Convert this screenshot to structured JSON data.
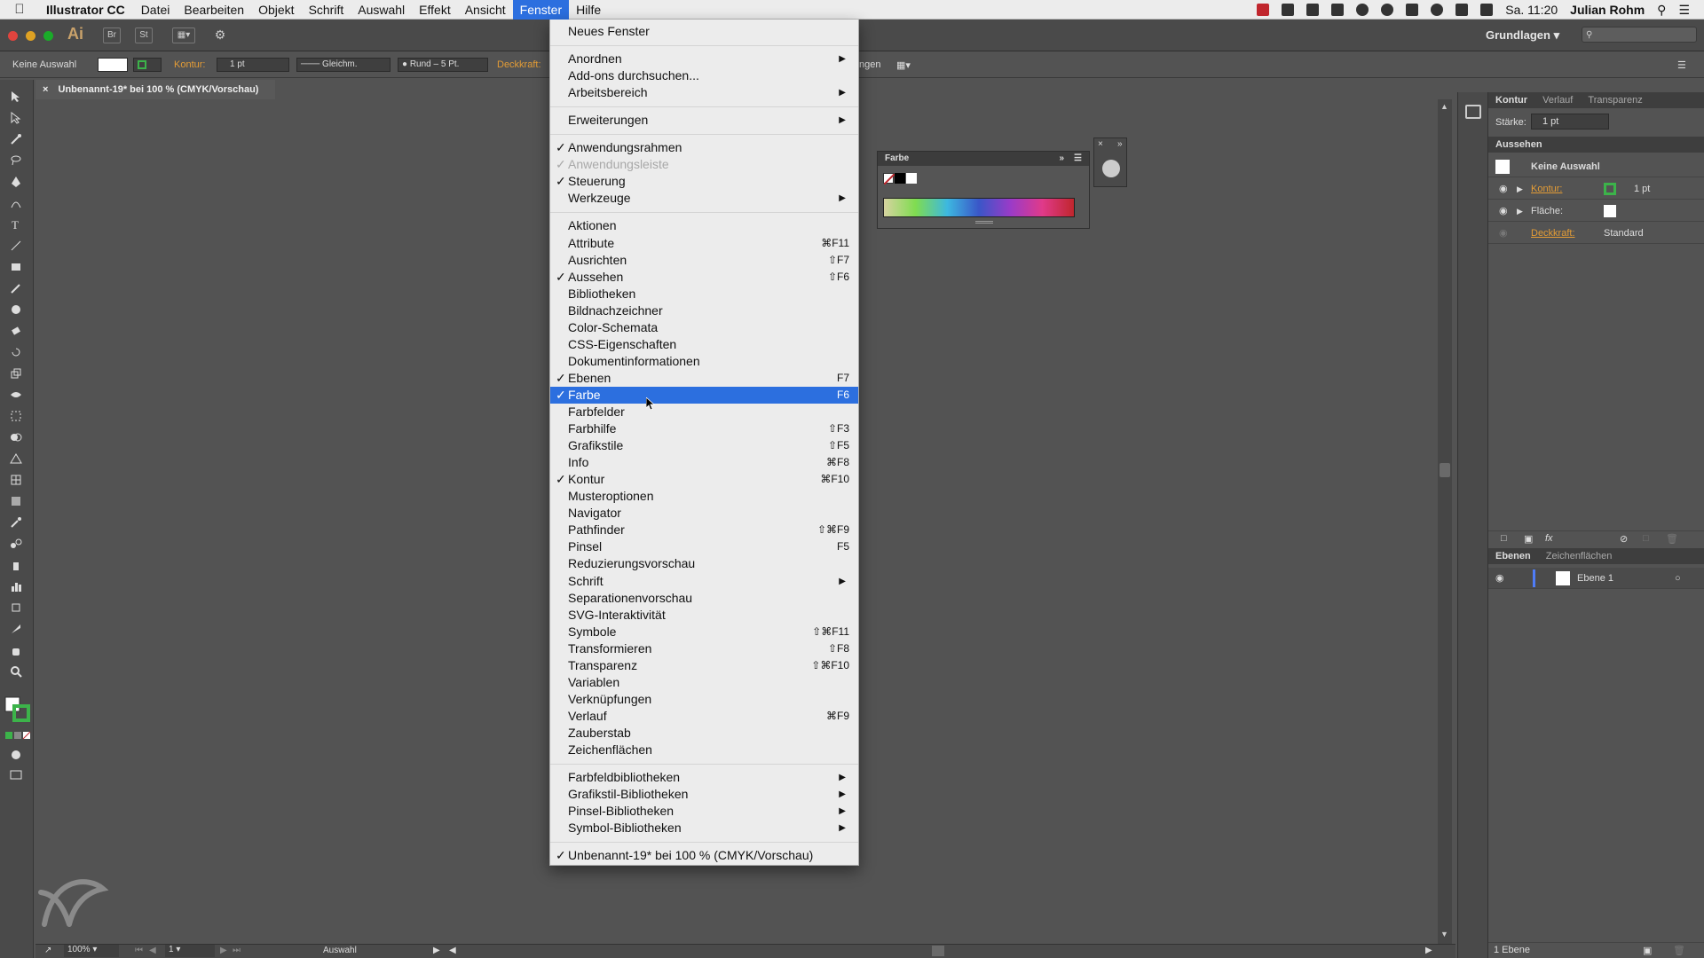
{
  "menubar": {
    "app_name": "Illustrator CC",
    "items": [
      "Datei",
      "Bearbeiten",
      "Objekt",
      "Schrift",
      "Auswahl",
      "Effekt",
      "Ansicht",
      "Fenster",
      "Hilfe"
    ],
    "active_item": "Fenster",
    "clock": "Sa. 11:20",
    "user": "Julian Rohm"
  },
  "appbar": {
    "logo": "Ai",
    "bridge": "Br",
    "stock": "St",
    "workspace": "Grundlagen"
  },
  "controlbar": {
    "selection": "Keine Auswahl",
    "stroke_label": "Kontur:",
    "stroke_value": "1 pt",
    "stroke_profile": "Gleichm.",
    "brush": "Rund – 5 Pt.",
    "opacity_label": "Deckkraft:",
    "partial": "ngen"
  },
  "document_tab": {
    "title": "Unbenannt-19* bei 100 % (CMYK/Vorschau)"
  },
  "fenster_menu": {
    "items": [
      {
        "label": "Neues Fenster",
        "checked": false,
        "shortcut": "",
        "submenu": false,
        "top": 0
      },
      {
        "label": "Anordnen",
        "checked": false,
        "shortcut": "",
        "submenu": true
      },
      {
        "label": "Add-ons durchsuchen...",
        "checked": false,
        "shortcut": "",
        "submenu": false
      },
      {
        "label": "Arbeitsbereich",
        "checked": false,
        "shortcut": "",
        "submenu": true
      },
      {
        "label": "Erweiterungen",
        "checked": false,
        "shortcut": "",
        "submenu": true
      },
      {
        "label": "Anwendungsrahmen",
        "checked": true,
        "shortcut": "",
        "submenu": false
      },
      {
        "label": "Anwendungsleiste",
        "checked": true,
        "shortcut": "",
        "submenu": false,
        "disabled": true
      },
      {
        "label": "Steuerung",
        "checked": true,
        "shortcut": "",
        "submenu": false
      },
      {
        "label": "Werkzeuge",
        "checked": false,
        "shortcut": "",
        "submenu": true
      },
      {
        "label": "Aktionen",
        "checked": false,
        "shortcut": "",
        "submenu": false
      },
      {
        "label": "Attribute",
        "checked": false,
        "shortcut": "⌘F11",
        "submenu": false
      },
      {
        "label": "Ausrichten",
        "checked": false,
        "shortcut": "⇧F7",
        "submenu": false
      },
      {
        "label": "Aussehen",
        "checked": true,
        "shortcut": "⇧F6",
        "submenu": false
      },
      {
        "label": "Bibliotheken",
        "checked": false,
        "shortcut": "",
        "submenu": false
      },
      {
        "label": "Bildnachzeichner",
        "checked": false,
        "shortcut": "",
        "submenu": false
      },
      {
        "label": "Color-Schemata",
        "checked": false,
        "shortcut": "",
        "submenu": false
      },
      {
        "label": "CSS-Eigenschaften",
        "checked": false,
        "shortcut": "",
        "submenu": false
      },
      {
        "label": "Dokumentinformationen",
        "checked": false,
        "shortcut": "",
        "submenu": false
      },
      {
        "label": "Ebenen",
        "checked": true,
        "shortcut": "F7",
        "submenu": false
      },
      {
        "label": "Farbe",
        "checked": true,
        "shortcut": "F6",
        "submenu": false,
        "highlight": true
      },
      {
        "label": "Farbfelder",
        "checked": false,
        "shortcut": "",
        "submenu": false
      },
      {
        "label": "Farbhilfe",
        "checked": false,
        "shortcut": "⇧F3",
        "submenu": false
      },
      {
        "label": "Grafikstile",
        "checked": false,
        "shortcut": "⇧F5",
        "submenu": false
      },
      {
        "label": "Info",
        "checked": false,
        "shortcut": "⌘F8",
        "submenu": false
      },
      {
        "label": "Kontur",
        "checked": true,
        "shortcut": "⌘F10",
        "submenu": false
      },
      {
        "label": "Musteroptionen",
        "checked": false,
        "shortcut": "",
        "submenu": false
      },
      {
        "label": "Navigator",
        "checked": false,
        "shortcut": "",
        "submenu": false
      },
      {
        "label": "Pathfinder",
        "checked": false,
        "shortcut": "⇧⌘F9",
        "submenu": false
      },
      {
        "label": "Pinsel",
        "checked": false,
        "shortcut": "F5",
        "submenu": false
      },
      {
        "label": "Reduzierungsvorschau",
        "checked": false,
        "shortcut": "",
        "submenu": false
      },
      {
        "label": "Schrift",
        "checked": false,
        "shortcut": "",
        "submenu": true
      },
      {
        "label": "Separationenvorschau",
        "checked": false,
        "shortcut": "",
        "submenu": false
      },
      {
        "label": "SVG-Interaktivität",
        "checked": false,
        "shortcut": "",
        "submenu": false
      },
      {
        "label": "Symbole",
        "checked": false,
        "shortcut": "⇧⌘F11",
        "submenu": false
      },
      {
        "label": "Transformieren",
        "checked": false,
        "shortcut": "⇧F8",
        "submenu": false
      },
      {
        "label": "Transparenz",
        "checked": false,
        "shortcut": "⇧⌘F10",
        "submenu": false
      },
      {
        "label": "Variablen",
        "checked": false,
        "shortcut": "",
        "submenu": false
      },
      {
        "label": "Verknüpfungen",
        "checked": false,
        "shortcut": "",
        "submenu": false
      },
      {
        "label": "Verlauf",
        "checked": false,
        "shortcut": "⌘F9",
        "submenu": false
      },
      {
        "label": "Zauberstab",
        "checked": false,
        "shortcut": "",
        "submenu": false
      },
      {
        "label": "Zeichenflächen",
        "checked": false,
        "shortcut": "",
        "submenu": false
      },
      {
        "label": "Farbfeldbibliotheken",
        "checked": false,
        "shortcut": "",
        "submenu": true
      },
      {
        "label": "Grafikstil-Bibliotheken",
        "checked": false,
        "shortcut": "",
        "submenu": true
      },
      {
        "label": "Pinsel-Bibliotheken",
        "checked": false,
        "shortcut": "",
        "submenu": true
      },
      {
        "label": "Symbol-Bibliotheken",
        "checked": false,
        "shortcut": "",
        "submenu": true
      },
      {
        "label": "Unbenannt-19* bei 100 % (CMYK/Vorschau)",
        "checked": true,
        "shortcut": "",
        "submenu": false
      }
    ]
  },
  "farbe_panel": {
    "title": "Farbe"
  },
  "right_panels": {
    "tabs_top": [
      "Kontur",
      "Verlauf",
      "Transparenz"
    ],
    "staerke_label": "Stärke:",
    "staerke_value": "1 pt",
    "aussehen_title": "Aussehen",
    "aussehen_rows": {
      "selection": "Keine Auswahl",
      "kontur_label": "Kontur:",
      "kontur_value": "1 pt",
      "flaeche_label": "Fläche:",
      "deckkraft_label": "Deckkraft:",
      "deckkraft_value": "Standard"
    },
    "layers_tabs": [
      "Ebenen",
      "Zeichenflächen"
    ],
    "layer_name": "Ebene 1",
    "layer_count": "1 Ebene"
  },
  "statusbar": {
    "zoom": "100%",
    "artboard": "1",
    "tool": "Auswahl"
  },
  "colors": {
    "menu_highlight": "#2c6fdf",
    "panel_bg": "#535353",
    "orange_label": "#e39c36"
  }
}
